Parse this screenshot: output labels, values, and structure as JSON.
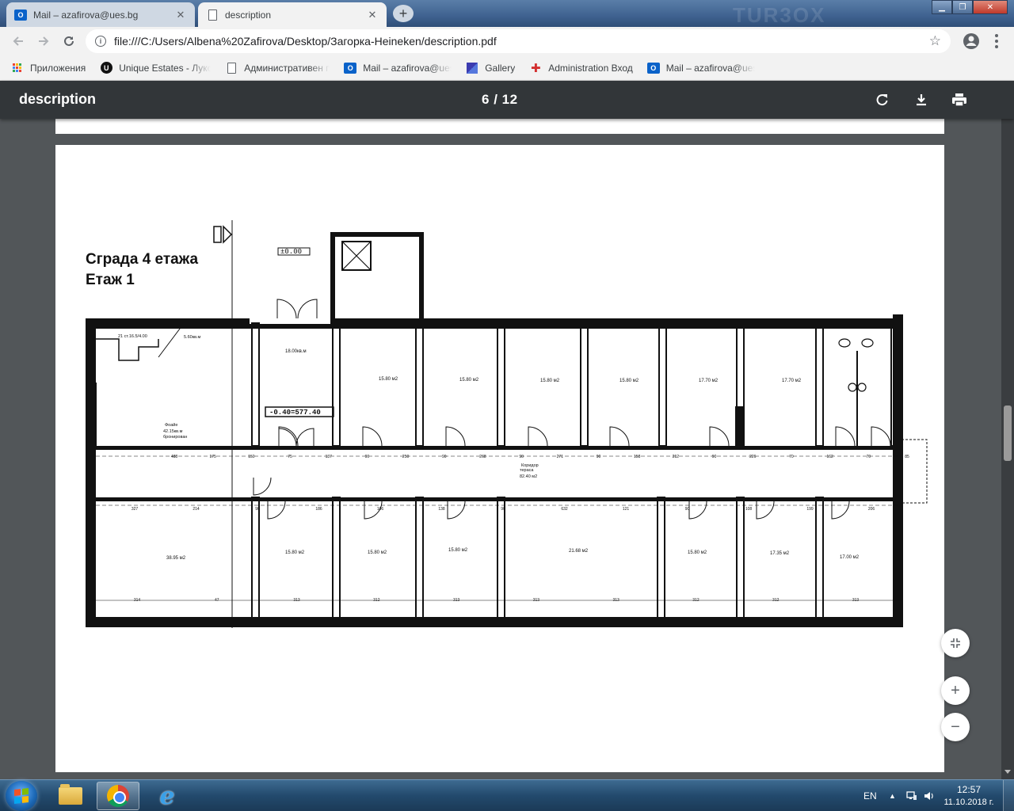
{
  "tabs": [
    {
      "title": "Mail – azafirova@ues.bg",
      "icon": "outlook-icon",
      "active": false
    },
    {
      "title": "description",
      "icon": "document-icon",
      "active": true
    }
  ],
  "address_bar": {
    "url": "file:///C:/Users/Albena%20Zafirova/Desktop/Загорка-Heineken/description.pdf"
  },
  "bookmarks": [
    {
      "label": "Приложения",
      "icon": "apps-grid-icon"
    },
    {
      "label": "Unique Estates - Лукс",
      "icon": "unique-estates-icon"
    },
    {
      "label": "Административен п",
      "icon": "page-icon"
    },
    {
      "label": "Mail – azafirova@ues",
      "icon": "outlook-icon"
    },
    {
      "label": "Gallery",
      "icon": "gallery-icon"
    },
    {
      "label": "Administration Вход",
      "icon": "plus-icon"
    },
    {
      "label": "Mail – azafirova@ues",
      "icon": "outlook-icon"
    }
  ],
  "pdf_viewer": {
    "title": "description",
    "current_page": "6",
    "separator": "/",
    "total_pages": "12"
  },
  "plan": {
    "title_line1": "Сграда 4 етажа",
    "title_line2": "Етаж 1",
    "level_mark": "±0.00",
    "elevation_mark": "-0.40=577.40",
    "stair_note": "21 ст.16.5/4.00",
    "stair_area": "5.60кв.м",
    "lobby_area": "18.00кв.м",
    "foyer_label": "Фоайе",
    "foyer_area": "42.15кв.м",
    "foyer_note": "бронирован",
    "corridor_label": "Коридор",
    "corridor_note": "тераса",
    "corridor_area": "82.40 м2",
    "top_rooms": [
      "15.80 м2",
      "15.80 м2",
      "15.80 м2",
      "15.80 м2",
      "17.70 м2",
      "17.70 м2"
    ],
    "bottom_rooms": [
      "38.95 м2",
      "15.80 м2",
      "15.80 м2",
      "15.80 м2",
      "21.68 м2",
      "15.80 м2",
      "17.35 м2",
      "17.00 м2"
    ],
    "corridor_dims_top": [
      "488",
      "175",
      "150",
      "75",
      "137",
      "90",
      "250",
      "90",
      "268",
      "90",
      "271",
      "90",
      "158",
      "212",
      "90",
      "226",
      "70",
      "162",
      "70",
      "85"
    ],
    "corridor_dims_bottom": [
      "327",
      "214",
      "90",
      "186",
      "106",
      "138",
      "90",
      "632",
      "121",
      "90",
      "108",
      "199",
      "206"
    ],
    "bottom_dims": [
      "314",
      "47",
      "313",
      "312",
      "313",
      "313",
      "313",
      "312",
      "312",
      "313"
    ]
  },
  "taskbar": {
    "language": "EN",
    "time": "12:57",
    "date": "11.10.2018 г."
  },
  "colors": {
    "pdf_toolbar": "#323639",
    "pdf_background": "#525659",
    "chrome_frame": "#f2f2f2"
  }
}
